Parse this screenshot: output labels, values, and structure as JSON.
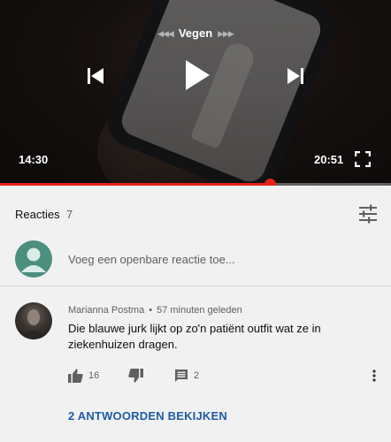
{
  "player": {
    "seek_label": "Vegen",
    "time_current": "14:30",
    "time_total": "20:51",
    "progress_fraction": 0.69,
    "progress_color": "#e62117"
  },
  "icons": {
    "prev": "skip-previous-icon",
    "play": "play-icon",
    "next": "skip-next-icon",
    "fullscreen": "fullscreen-icon",
    "sort": "sort-sliders-icon",
    "like": "thumb-up-icon",
    "dislike": "thumb-down-icon",
    "reply": "comment-icon",
    "more": "more-vertical-icon"
  },
  "comments": {
    "title": "Reacties",
    "count": "7",
    "add_placeholder": "Voeg een openbare reactie toe...",
    "items": [
      {
        "author": "Marianna Postma",
        "separator": "•",
        "time": "57 minuten geleden",
        "text": "Die blauwe jurk lijkt op zo'n patiënt outfit wat ze in ziekenhuizen dragen.",
        "likes": "16",
        "replies": "2",
        "view_replies_label": "2 ANTWOORDEN BEKIJKEN"
      }
    ]
  },
  "colors": {
    "accent_link": "#1f5aa6",
    "avatar_default": "#4c8f7f"
  }
}
